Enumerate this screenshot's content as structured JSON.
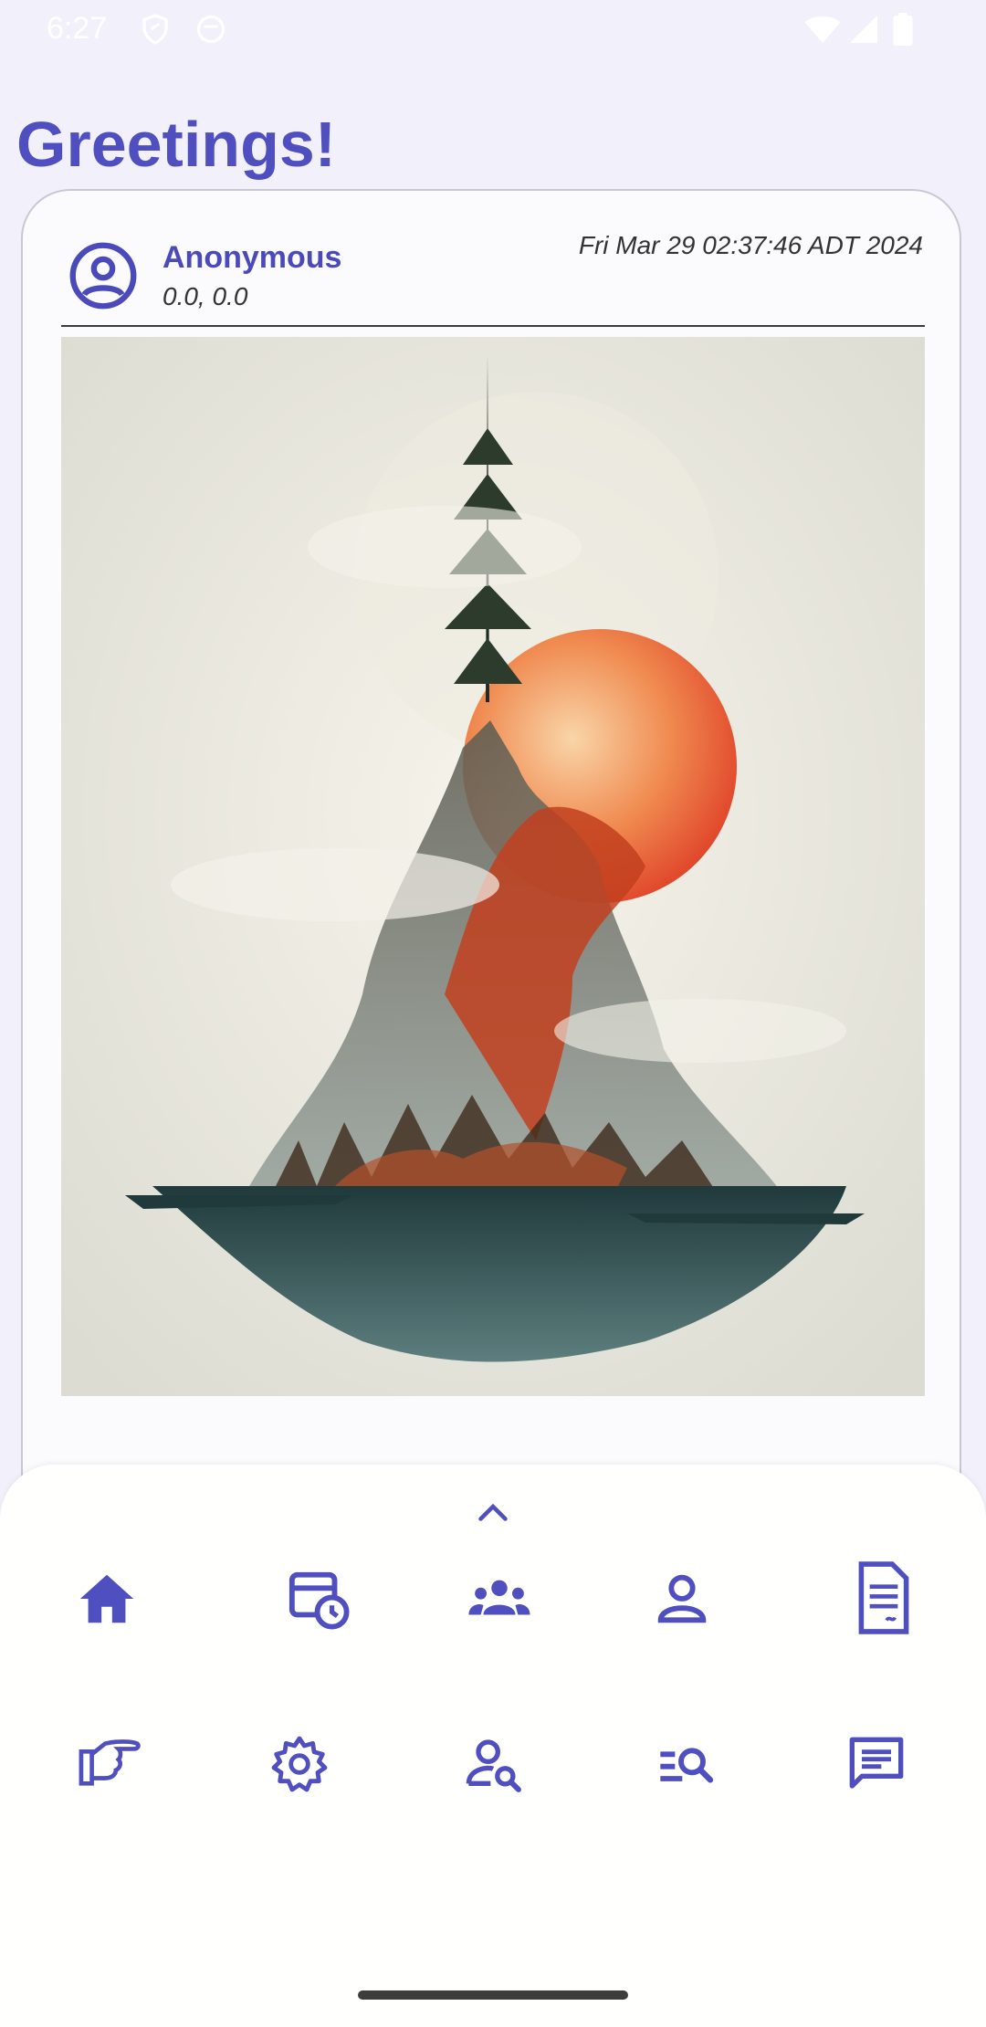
{
  "status_bar": {
    "time": "6:27"
  },
  "header": {
    "greeting": "Greetings!"
  },
  "post": {
    "author": "Anonymous",
    "coordinates": "0.0, 0.0",
    "timestamp": "Fri Mar 29 02:37:46 ADT 2024",
    "image_icon": "landscape-painting"
  },
  "fab": {
    "icon": "plus-icon"
  },
  "bottom_sheet": {
    "row1": [
      "home-icon",
      "schedule-icon",
      "groups-icon",
      "person-icon",
      "document-icon"
    ],
    "row2": [
      "pointing-hand-icon",
      "settings-icon",
      "person-search-icon",
      "list-search-icon",
      "chat-icon"
    ]
  },
  "colors": {
    "accent": "#4f4fc0",
    "background": "#f2f1fb",
    "fab": "#e8def8"
  }
}
